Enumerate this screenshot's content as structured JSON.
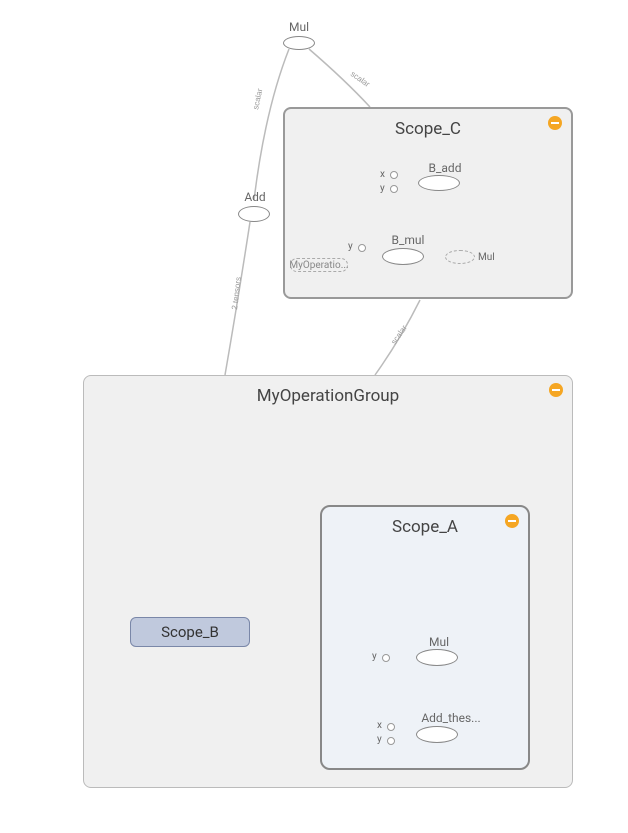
{
  "nodes": {
    "mul_top": {
      "label": "Mul"
    },
    "add_node": {
      "label": "Add"
    },
    "scope_c": {
      "title": "Scope_C",
      "b_add": {
        "label": "B_add",
        "ports": [
          "x",
          "y"
        ]
      },
      "b_mul": {
        "label": "B_mul",
        "port": "y",
        "ref_left": "MyOperatio...",
        "ref_right": "Mul"
      }
    },
    "my_op_group": {
      "title": "MyOperationGroup",
      "scope_b": {
        "label": "Scope_B"
      },
      "scope_a": {
        "title": "Scope_A",
        "mul": {
          "label": "Mul",
          "port": "y"
        },
        "add_these": {
          "label": "Add_thes...",
          "ports": [
            "x",
            "y"
          ]
        }
      }
    }
  },
  "edge_labels": {
    "scalar": "scalar",
    "two_tensors": "2 tensors"
  }
}
